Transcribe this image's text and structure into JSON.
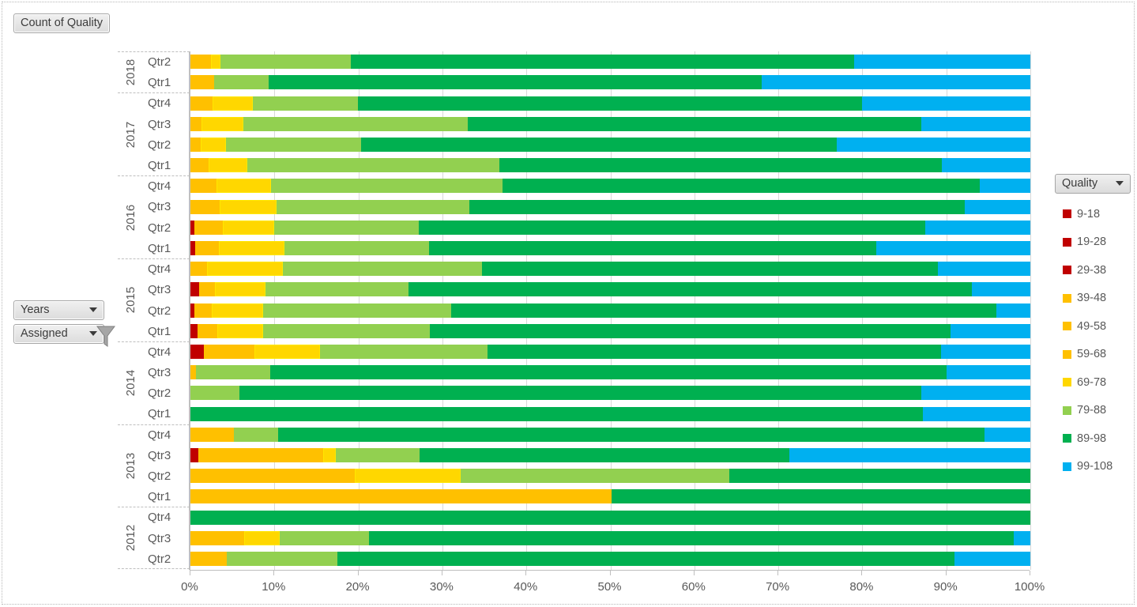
{
  "header": {
    "title": "Count of Quality"
  },
  "slicers": [
    {
      "label": "Years",
      "name": "years-button",
      "has_filter_icon": false
    },
    {
      "label": "Assigned",
      "name": "assigned-button",
      "has_filter_icon": true
    }
  ],
  "legend": {
    "title": "Quality",
    "position": "right",
    "entries": [
      {
        "label": "9-18",
        "color": "#C00000"
      },
      {
        "label": "19-28",
        "color": "#C00000"
      },
      {
        "label": "29-38",
        "color": "#C00000"
      },
      {
        "label": "39-48",
        "color": "#FFC000"
      },
      {
        "label": "49-58",
        "color": "#FFC000"
      },
      {
        "label": "59-68",
        "color": "#FFC000"
      },
      {
        "label": "69-78",
        "color": "#FFD700"
      },
      {
        "label": "79-88",
        "color": "#92D050"
      },
      {
        "label": "89-98",
        "color": "#00B050"
      },
      {
        "label": "99-108",
        "color": "#00B0F0"
      }
    ]
  },
  "chart_data": {
    "type": "bar",
    "orientation": "horizontal",
    "stacked": "100%",
    "title": "Count of Quality",
    "xlabel": "",
    "ylabel": "",
    "xlim": [
      0,
      100
    ],
    "xticks": [
      "0%",
      "10%",
      "20%",
      "30%",
      "40%",
      "50%",
      "60%",
      "70%",
      "80%",
      "90%",
      "100%"
    ],
    "grid": "vertical",
    "series_names": [
      "9-18",
      "19-28",
      "29-38",
      "39-48",
      "49-58",
      "59-68",
      "69-78",
      "79-88",
      "89-98",
      "99-108"
    ],
    "series_colors": [
      "#C00000",
      "#C00000",
      "#C00000",
      "#FFC000",
      "#FFC000",
      "#FFC000",
      "#FFD700",
      "#92D050",
      "#00B050",
      "#00B0F0"
    ],
    "groups": [
      {
        "year": "2018",
        "rows": [
          {
            "category": "Qtr2",
            "values": [
              0,
              0,
              0,
              0,
              2.4,
              0,
              1.2,
              15.5,
              59.9,
              21.0
            ]
          },
          {
            "category": "Qtr1",
            "values": [
              0,
              0,
              0,
              0,
              2.8,
              0,
              0,
              6.5,
              58.7,
              32.0
            ]
          }
        ]
      },
      {
        "year": "2017",
        "rows": [
          {
            "category": "Qtr4",
            "values": [
              0,
              0,
              0,
              0,
              2.6,
              0,
              4.8,
              12.5,
              60.1,
              20.0
            ]
          },
          {
            "category": "Qtr3",
            "values": [
              0,
              0,
              0,
              0,
              1.3,
              0,
              5.0,
              26.7,
              54.0,
              13.0
            ]
          },
          {
            "category": "Qtr2",
            "values": [
              0,
              0,
              0,
              0,
              1.2,
              0,
              3.0,
              16.1,
              56.7,
              23.0
            ]
          },
          {
            "category": "Qtr1",
            "values": [
              0,
              0,
              0,
              0,
              2.2,
              0,
              4.6,
              30.0,
              52.7,
              10.5
            ]
          }
        ]
      },
      {
        "year": "2016",
        "rows": [
          {
            "category": "Qtr4",
            "values": [
              0,
              0,
              0,
              0,
              3.1,
              0,
              6.5,
              27.6,
              56.8,
              6.0
            ]
          },
          {
            "category": "Qtr3",
            "values": [
              0,
              0,
              0,
              0,
              3.5,
              0,
              6.8,
              22.9,
              59.0,
              7.8
            ]
          },
          {
            "category": "Qtr2",
            "values": [
              0.5,
              0,
              0,
              0,
              3.4,
              0,
              6.1,
              17.2,
              60.3,
              12.5
            ]
          },
          {
            "category": "Qtr1",
            "values": [
              0.6,
              0,
              0,
              0,
              2.8,
              0,
              7.8,
              17.2,
              53.3,
              18.3
            ]
          }
        ]
      },
      {
        "year": "2015",
        "rows": [
          {
            "category": "Qtr4",
            "values": [
              0,
              0,
              0,
              0,
              2.0,
              0,
              9.0,
              23.7,
              54.3,
              11.0
            ]
          },
          {
            "category": "Qtr3",
            "values": [
              1.0,
              0,
              0,
              0,
              1.9,
              0,
              6.0,
              17.1,
              67.0,
              7.0
            ]
          },
          {
            "category": "Qtr2",
            "values": [
              0.5,
              0,
              0,
              0,
              2.0,
              0,
              6.2,
              22.3,
              65.0,
              4.0
            ]
          },
          {
            "category": "Qtr1",
            "values": [
              0.8,
              0,
              0,
              0,
              2.4,
              0,
              5.5,
              19.8,
              62.0,
              9.5
            ]
          }
        ]
      },
      {
        "year": "2014",
        "rows": [
          {
            "category": "Qtr4",
            "values": [
              1.6,
              0,
              0,
              0,
              6.0,
              0,
              7.8,
              20.0,
              54.0,
              10.6
            ]
          },
          {
            "category": "Qtr3",
            "values": [
              0,
              0,
              0,
              0,
              0.7,
              0,
              0,
              8.8,
              80.5,
              10.0
            ]
          },
          {
            "category": "Qtr2",
            "values": [
              0,
              0,
              0,
              0,
              0,
              0,
              0,
              5.8,
              81.2,
              13.0
            ]
          },
          {
            "category": "Qtr1",
            "values": [
              0,
              0,
              0,
              0,
              0,
              0,
              0,
              0,
              87.2,
              12.8
            ]
          }
        ]
      },
      {
        "year": "2013",
        "rows": [
          {
            "category": "Qtr4",
            "values": [
              0,
              0,
              0,
              0,
              5.2,
              0,
              0,
              5.2,
              84.1,
              5.5
            ]
          },
          {
            "category": "Qtr3",
            "values": [
              0.9,
              0,
              0,
              0,
              14.9,
              0,
              1.5,
              10.0,
              44.0,
              28.7
            ]
          },
          {
            "category": "Qtr2",
            "values": [
              0,
              0,
              0,
              0,
              19.6,
              0,
              12.6,
              32.0,
              35.8,
              0
            ]
          },
          {
            "category": "Qtr1",
            "values": [
              0,
              0,
              0,
              0,
              50.1,
              0,
              0,
              0,
              49.9,
              0
            ]
          }
        ]
      },
      {
        "year": "2012",
        "rows": [
          {
            "category": "Qtr4",
            "values": [
              0,
              0,
              0,
              0,
              0,
              0,
              0,
              0,
              100.0,
              0
            ]
          },
          {
            "category": "Qtr3",
            "values": [
              0,
              0,
              0,
              0,
              6.4,
              0,
              4.2,
              10.7,
              76.7,
              2.0
            ]
          },
          {
            "category": "Qtr2",
            "values": [
              0,
              0,
              0,
              0,
              4.3,
              0,
              0,
              13.2,
              73.5,
              9.0
            ]
          }
        ]
      }
    ]
  }
}
